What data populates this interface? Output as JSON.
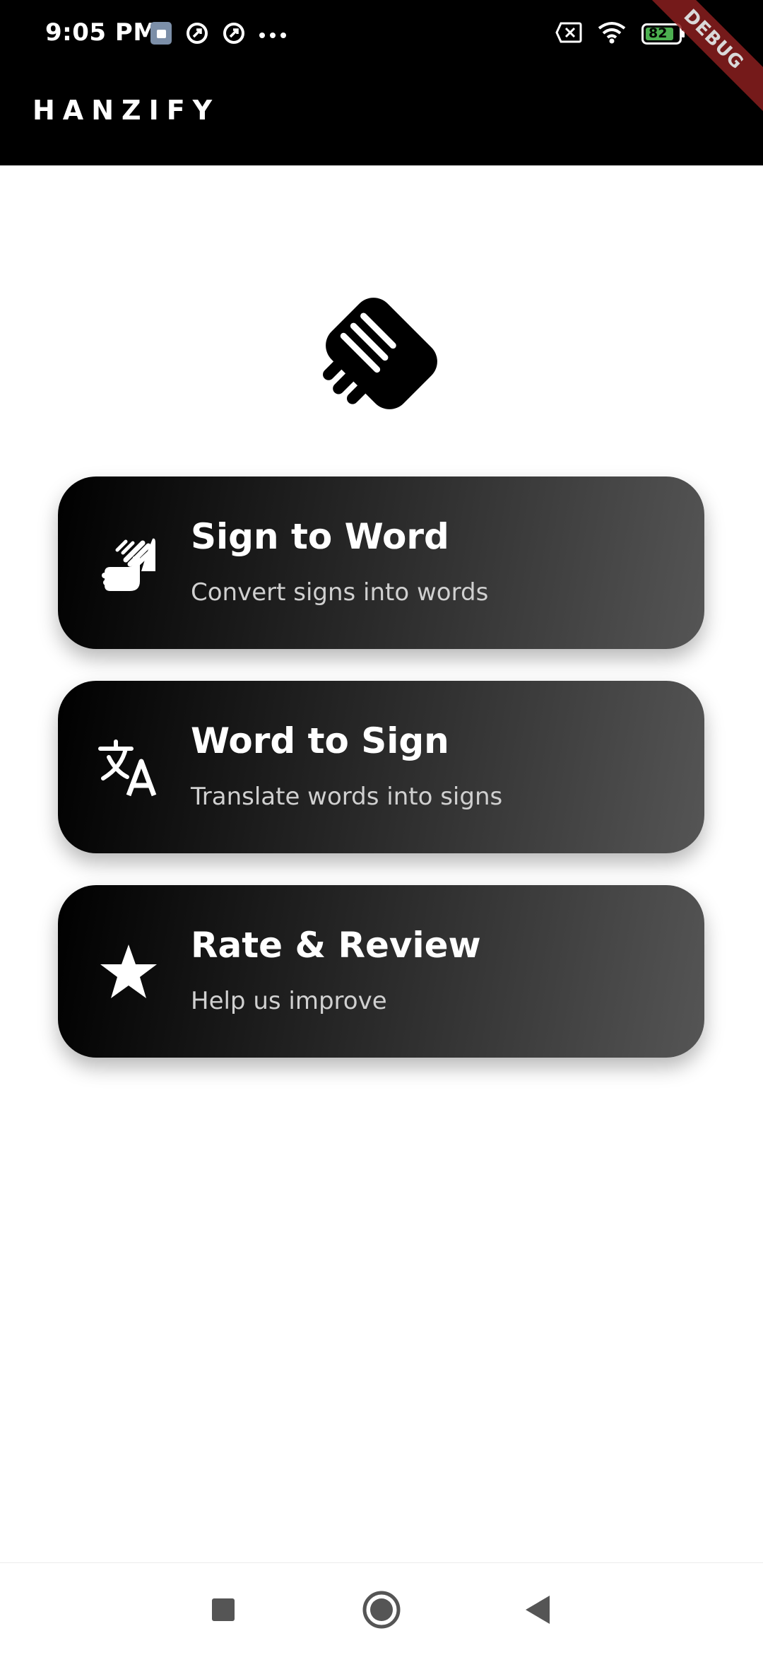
{
  "status_bar": {
    "time": "9:05 PM",
    "battery": "82",
    "icons": [
      "sim-card-icon",
      "sync-icon",
      "sync-icon",
      "more-dots-icon",
      "no-sim-icon",
      "wifi-icon",
      "battery-icon"
    ]
  },
  "debug_banner": {
    "label": "DEBUG"
  },
  "app_bar": {
    "title": "HANZIFY"
  },
  "logo": {
    "icon": "handshake-icon"
  },
  "menu": [
    {
      "title": "Sign to Word",
      "subtitle": "Convert signs into words",
      "icon": "sign-language-icon"
    },
    {
      "title": "Word to Sign",
      "subtitle": "Translate words into signs",
      "icon": "translate-icon"
    },
    {
      "title": "Rate & Review",
      "subtitle": "Help us improve",
      "icon": "star-icon"
    }
  ],
  "nav_bar": {
    "buttons": [
      "recents-button",
      "home-button",
      "back-button"
    ]
  },
  "colors": {
    "header": "#000000",
    "card_start": "#000000",
    "card_end": "#555555",
    "debug": "#8a1f1f",
    "battery": "#4caf50"
  }
}
